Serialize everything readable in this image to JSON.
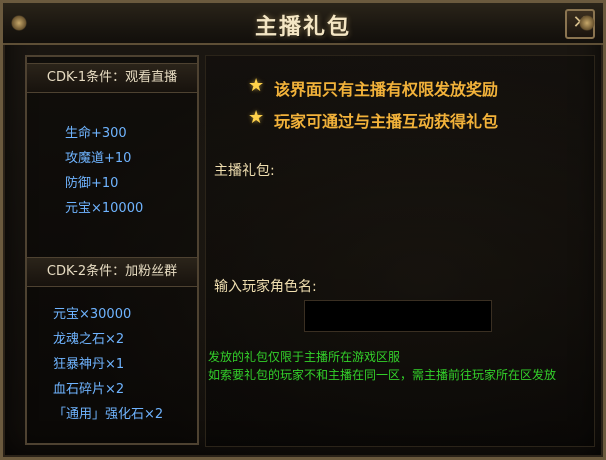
{
  "window": {
    "title": "主播礼包",
    "close_label": "✕"
  },
  "left_panel": {
    "cdk1": {
      "heading": "CDK-1条件：观看直播",
      "rewards": [
        "生命+300",
        "攻魔道+10",
        "防御+10",
        "元宝×10000"
      ]
    },
    "cdk2": {
      "heading": "CDK-2条件：加粉丝群",
      "rewards": [
        "元宝×30000",
        "龙魂之石×2",
        "狂暴神丹×1",
        "血石碎片×2",
        "「通用」强化石×2"
      ]
    }
  },
  "right_panel": {
    "notices": [
      "该界面只有主播有权限发放奖励",
      "玩家可通过与主播互动获得礼包"
    ],
    "gift_label": "主播礼包:",
    "player_name_label": "输入玩家角色名:",
    "player_name_value": "",
    "notes": [
      "发放的礼包仅限于主播所在游戏区服",
      "如索要礼包的玩家不和主播在同一区，需主播前往玩家所在区发放"
    ]
  },
  "icons": {
    "star": "star-icon",
    "close": "close-icon"
  },
  "colors": {
    "accent_gold": "#f2b23a",
    "reward_blue": "#6fb4ff",
    "note_green": "#33d12a",
    "title_text": "#f4e6c4"
  }
}
